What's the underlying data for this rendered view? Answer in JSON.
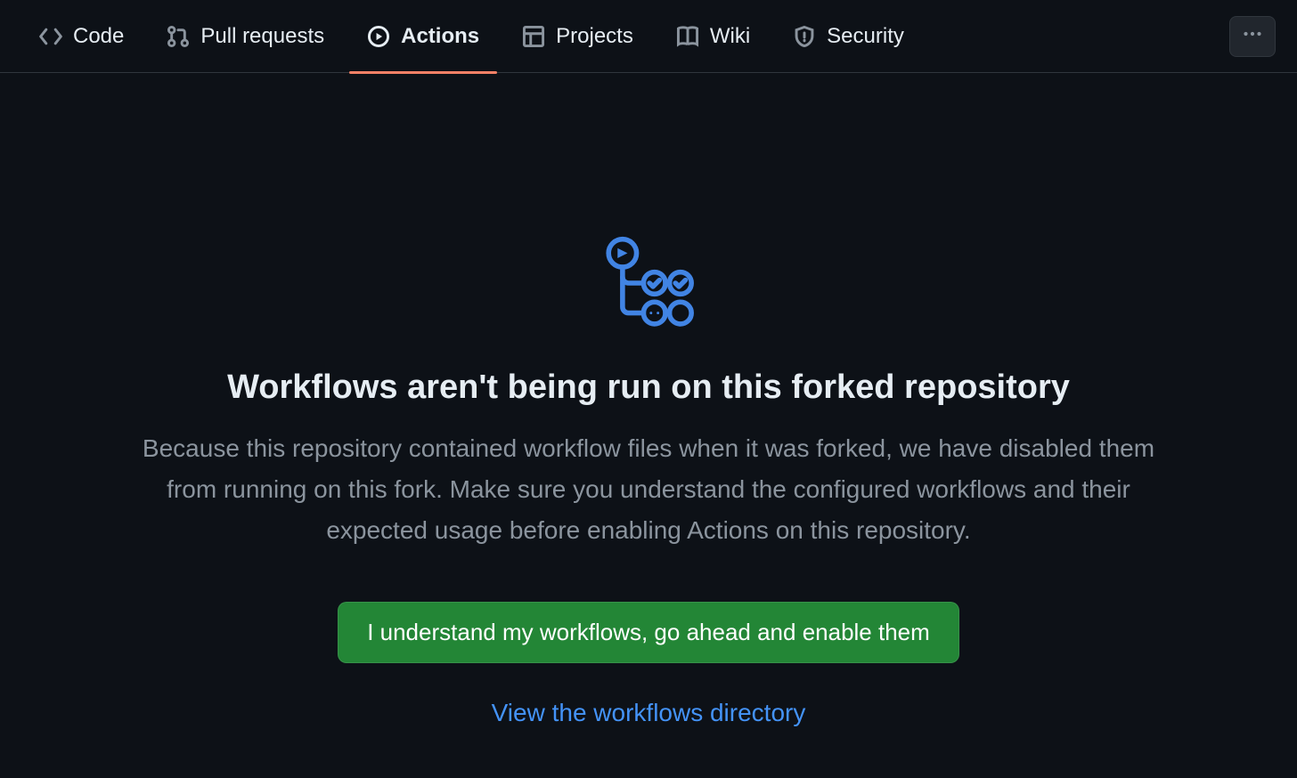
{
  "nav": {
    "tabs": [
      {
        "label": "Code",
        "icon": "code-icon"
      },
      {
        "label": "Pull requests",
        "icon": "git-pull-request-icon"
      },
      {
        "label": "Actions",
        "icon": "play-icon",
        "active": true
      },
      {
        "label": "Projects",
        "icon": "project-icon"
      },
      {
        "label": "Wiki",
        "icon": "book-icon"
      },
      {
        "label": "Security",
        "icon": "shield-icon"
      }
    ]
  },
  "main": {
    "title": "Workflows aren't being run on this forked repository",
    "description": "Because this repository contained workflow files when it was forked, we have disabled them from running on this fork. Make sure you understand the configured workflows and their expected usage before enabling Actions on this repository.",
    "enable_button_label": "I understand my workflows, go ahead and enable them",
    "view_link_label": "View the workflows directory"
  }
}
